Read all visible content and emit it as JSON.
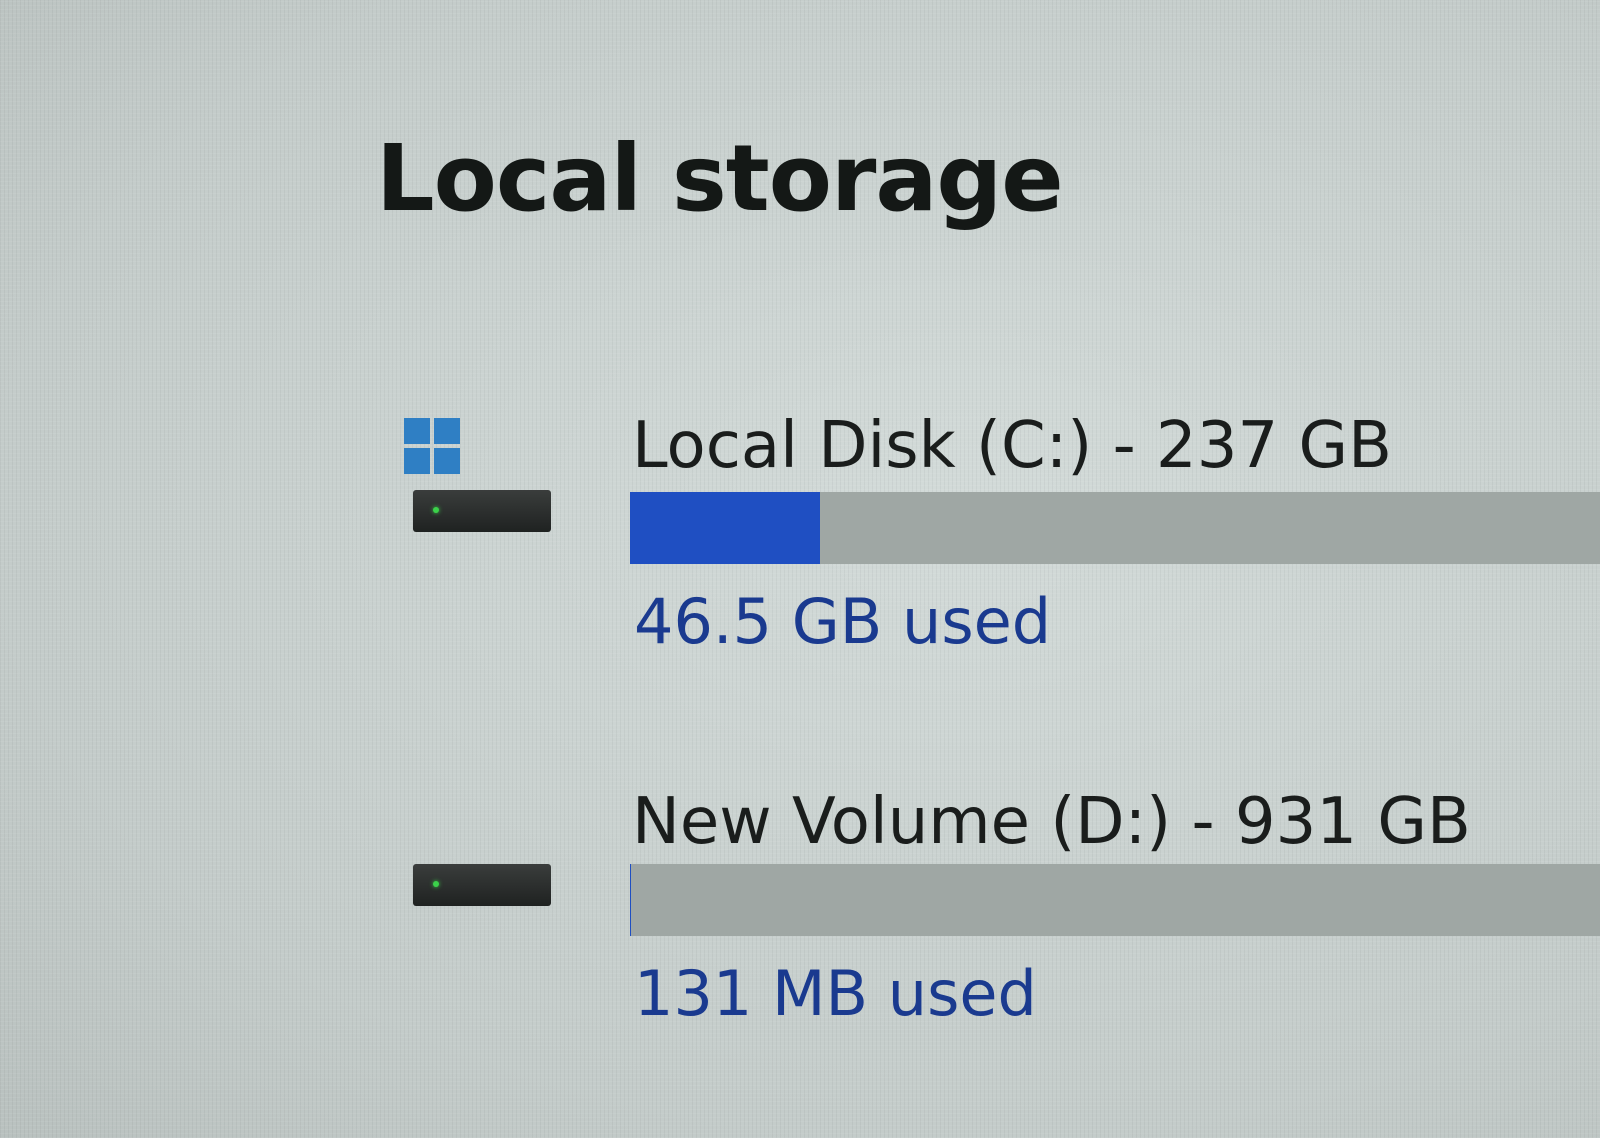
{
  "page": {
    "title": "Local storage"
  },
  "drives": [
    {
      "name": "Local Disk (C:) - 237 GB",
      "used_label": "46.5 GB used",
      "used_fraction": 0.196,
      "icon": "hard-drive-icon",
      "os_badge": "windows-logo-icon"
    },
    {
      "name": "New Volume (D:) - 931 GB",
      "used_label": "131 MB used",
      "used_fraction": 0.0001,
      "icon": "hard-drive-icon"
    }
  ],
  "colors": {
    "bar_fill": "#1f4fc2",
    "bar_track": "#9fa7a4",
    "used_text": "#1a3a8f",
    "windows_logo": "#2f7fc4"
  }
}
